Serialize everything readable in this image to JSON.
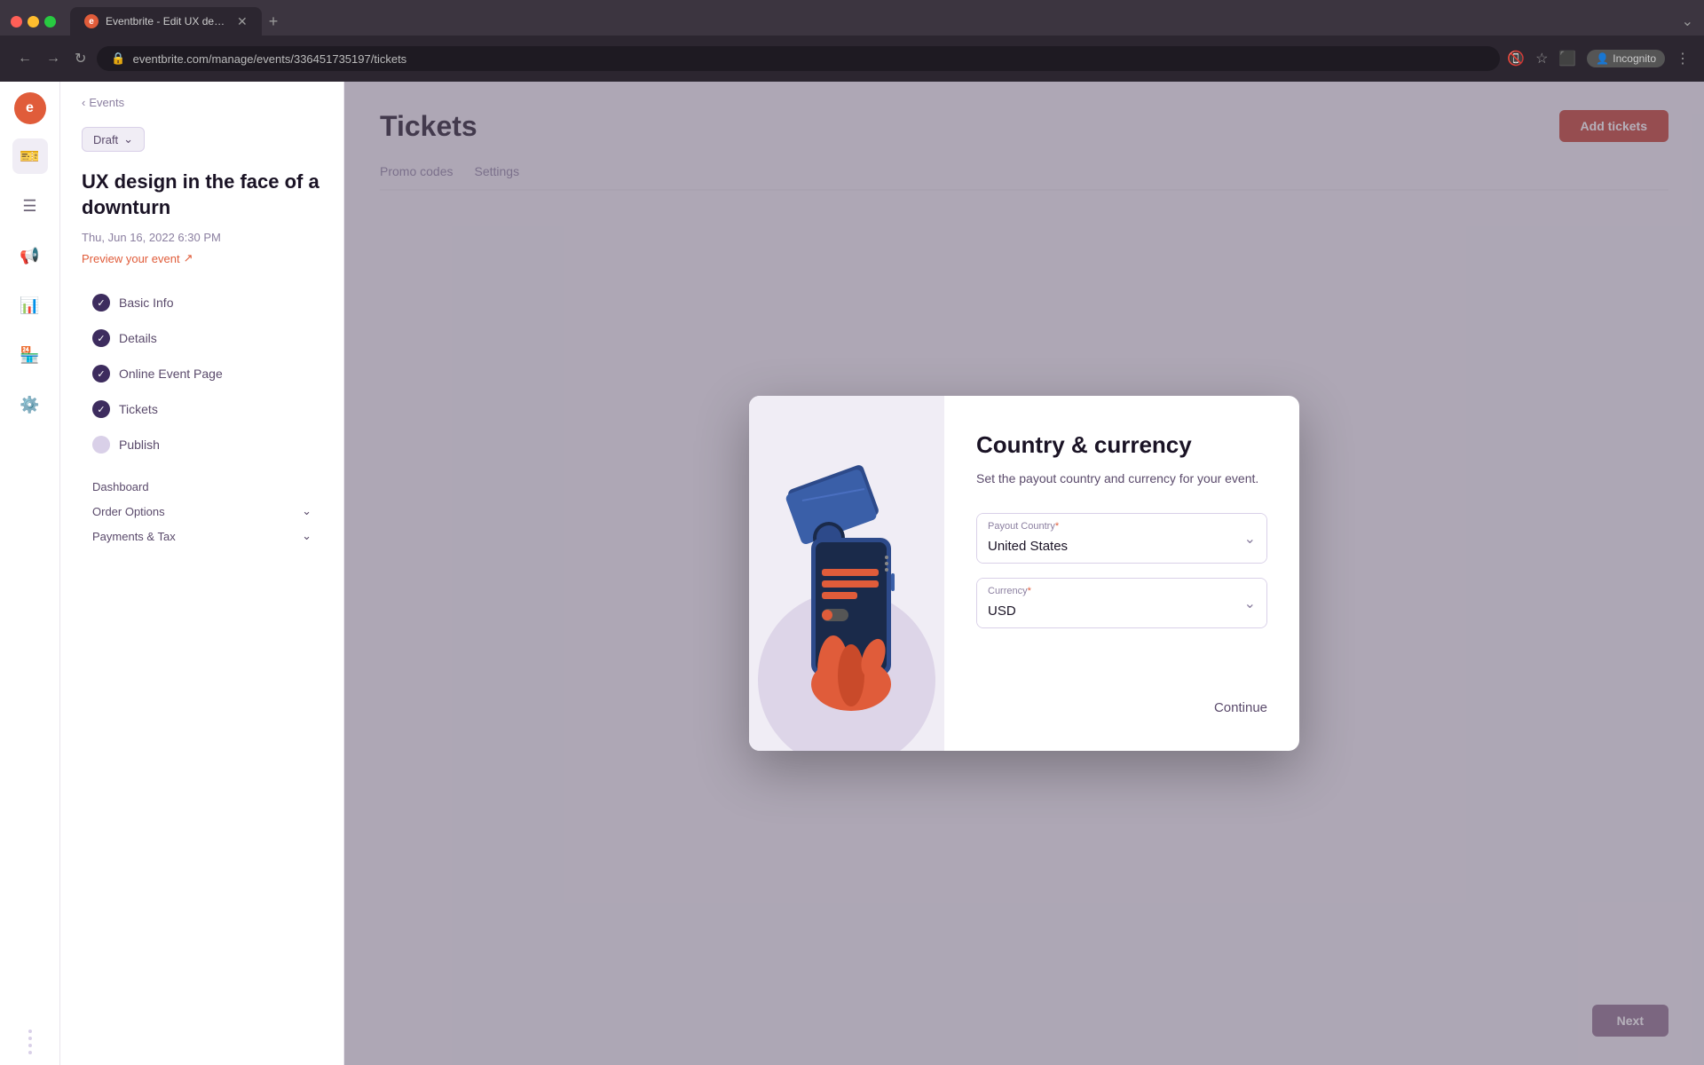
{
  "browser": {
    "tab_title": "Eventbrite - Edit UX design in ...",
    "tab_favicon": "e",
    "address": "eventbrite.com/manage/events/336451735197/tickets",
    "incognito_label": "Incognito"
  },
  "sidebar": {
    "logo": "e",
    "icons": [
      "☰",
      "📋",
      "📢",
      "📊",
      "🏪",
      "⚙️",
      "⋯⋯"
    ]
  },
  "left_panel": {
    "back_label": "Events",
    "draft_label": "Draft",
    "event_title": "UX design in the face of a downturn",
    "event_date": "Thu, Jun 16, 2022 6:30 PM",
    "preview_label": "Preview your event",
    "nav_items": [
      {
        "label": "Basic Info",
        "status": "check"
      },
      {
        "label": "Details",
        "status": "check"
      },
      {
        "label": "Online Event Page",
        "status": "check"
      },
      {
        "label": "Tickets",
        "status": "check"
      },
      {
        "label": "Publish",
        "status": "circle"
      }
    ],
    "nav_sections": [
      {
        "label": "Dashboard"
      },
      {
        "label": "Order Options",
        "has_arrow": true
      },
      {
        "label": "Payments & Tax",
        "has_arrow": true
      }
    ]
  },
  "page": {
    "title": "Tickets",
    "tabs": [
      {
        "label": "Promo codes"
      },
      {
        "label": "Settings"
      }
    ],
    "add_tickets_label": "Add tickets",
    "next_label": "Next"
  },
  "modal": {
    "title": "Country & currency",
    "description": "Set the payout country and currency for your event.",
    "payout_country_label": "Payout Country",
    "payout_country_required": "*",
    "payout_country_value": "United States",
    "currency_label": "Currency",
    "currency_required": "*",
    "currency_value": "USD",
    "continue_label": "Continue"
  }
}
